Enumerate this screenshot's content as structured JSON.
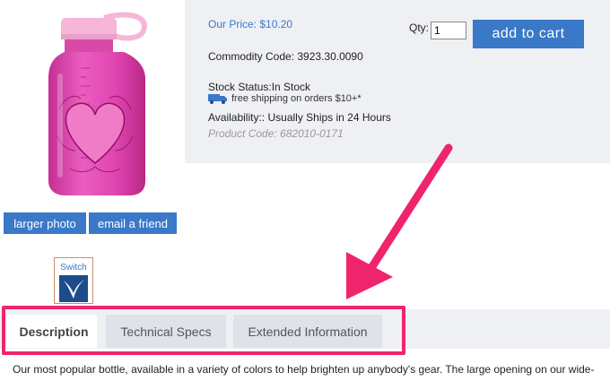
{
  "product": {
    "price_label": "Our Price:",
    "price_value": "$10.20",
    "qty_label": "Qty:",
    "qty_value": "1",
    "add_to_cart_label": "add to cart",
    "commodity_code": "Commodity Code: 3923.30.0090",
    "stock_status": "Stock Status:In Stock",
    "shipping_text": "free shipping on orders $10+*",
    "availability": "Availability:: Usually Ships in 24 Hours",
    "product_code": "Product Code: 682010-0171"
  },
  "image_actions": {
    "larger_photo_label": "larger photo",
    "email_friend_label": "email a friend"
  },
  "switch_badge": {
    "label": "Switch"
  },
  "tabs": [
    {
      "label": "Description",
      "active": true
    },
    {
      "label": "Technical Specs",
      "active": false
    },
    {
      "label": "Extended Information",
      "active": false
    }
  ],
  "description": {
    "text": "Our most popular bottle, available in a variety of colors to help brighten up anybody's gear.  The large opening on our wide-"
  },
  "colors": {
    "accent": "#3a78c8",
    "highlight": "#f0246c",
    "panel": "#eef0f4",
    "bottle": "#e040a8",
    "cap": "#f5b6d8"
  },
  "icons": {
    "shipping": "truck-icon",
    "switch_logo": "switch-logo-icon"
  }
}
